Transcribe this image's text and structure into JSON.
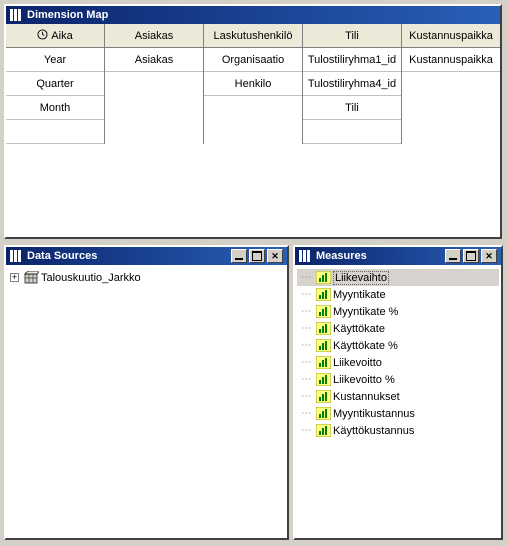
{
  "dimension_map": {
    "title": "Dimension Map",
    "columns": [
      {
        "header": "Aika",
        "has_icon": true,
        "cells": [
          "Year",
          "Quarter",
          "Month"
        ]
      },
      {
        "header": "Asiakas",
        "has_icon": false,
        "cells": [
          "Asiakas"
        ]
      },
      {
        "header": "Laskutushenkilö",
        "has_icon": false,
        "cells": [
          "Organisaatio",
          "Henkilo"
        ]
      },
      {
        "header": "Tili",
        "has_icon": false,
        "cells": [
          "Tulostiliryhma1_id",
          "Tulostiliryhma4_id",
          "Tili"
        ]
      },
      {
        "header": "Kustannuspaikka",
        "has_icon": false,
        "cells": [
          "Kustannuspaikka"
        ]
      }
    ]
  },
  "data_sources": {
    "title": "Data Sources",
    "items": [
      {
        "label": "Talouskuutio_Jarkko",
        "expandable": true
      }
    ]
  },
  "measures": {
    "title": "Measures",
    "items": [
      {
        "label": "Liikevaihto",
        "selected": true
      },
      {
        "label": "Myyntikate",
        "selected": false
      },
      {
        "label": "Myyntikate %",
        "selected": false
      },
      {
        "label": "Käyttökate",
        "selected": false
      },
      {
        "label": "Käyttökate %",
        "selected": false
      },
      {
        "label": "Liikevoitto",
        "selected": false
      },
      {
        "label": "Liikevoitto %",
        "selected": false
      },
      {
        "label": "Kustannukset",
        "selected": false
      },
      {
        "label": "Myyntikustannus",
        "selected": false
      },
      {
        "label": "Käyttökustannus",
        "selected": false
      }
    ]
  }
}
